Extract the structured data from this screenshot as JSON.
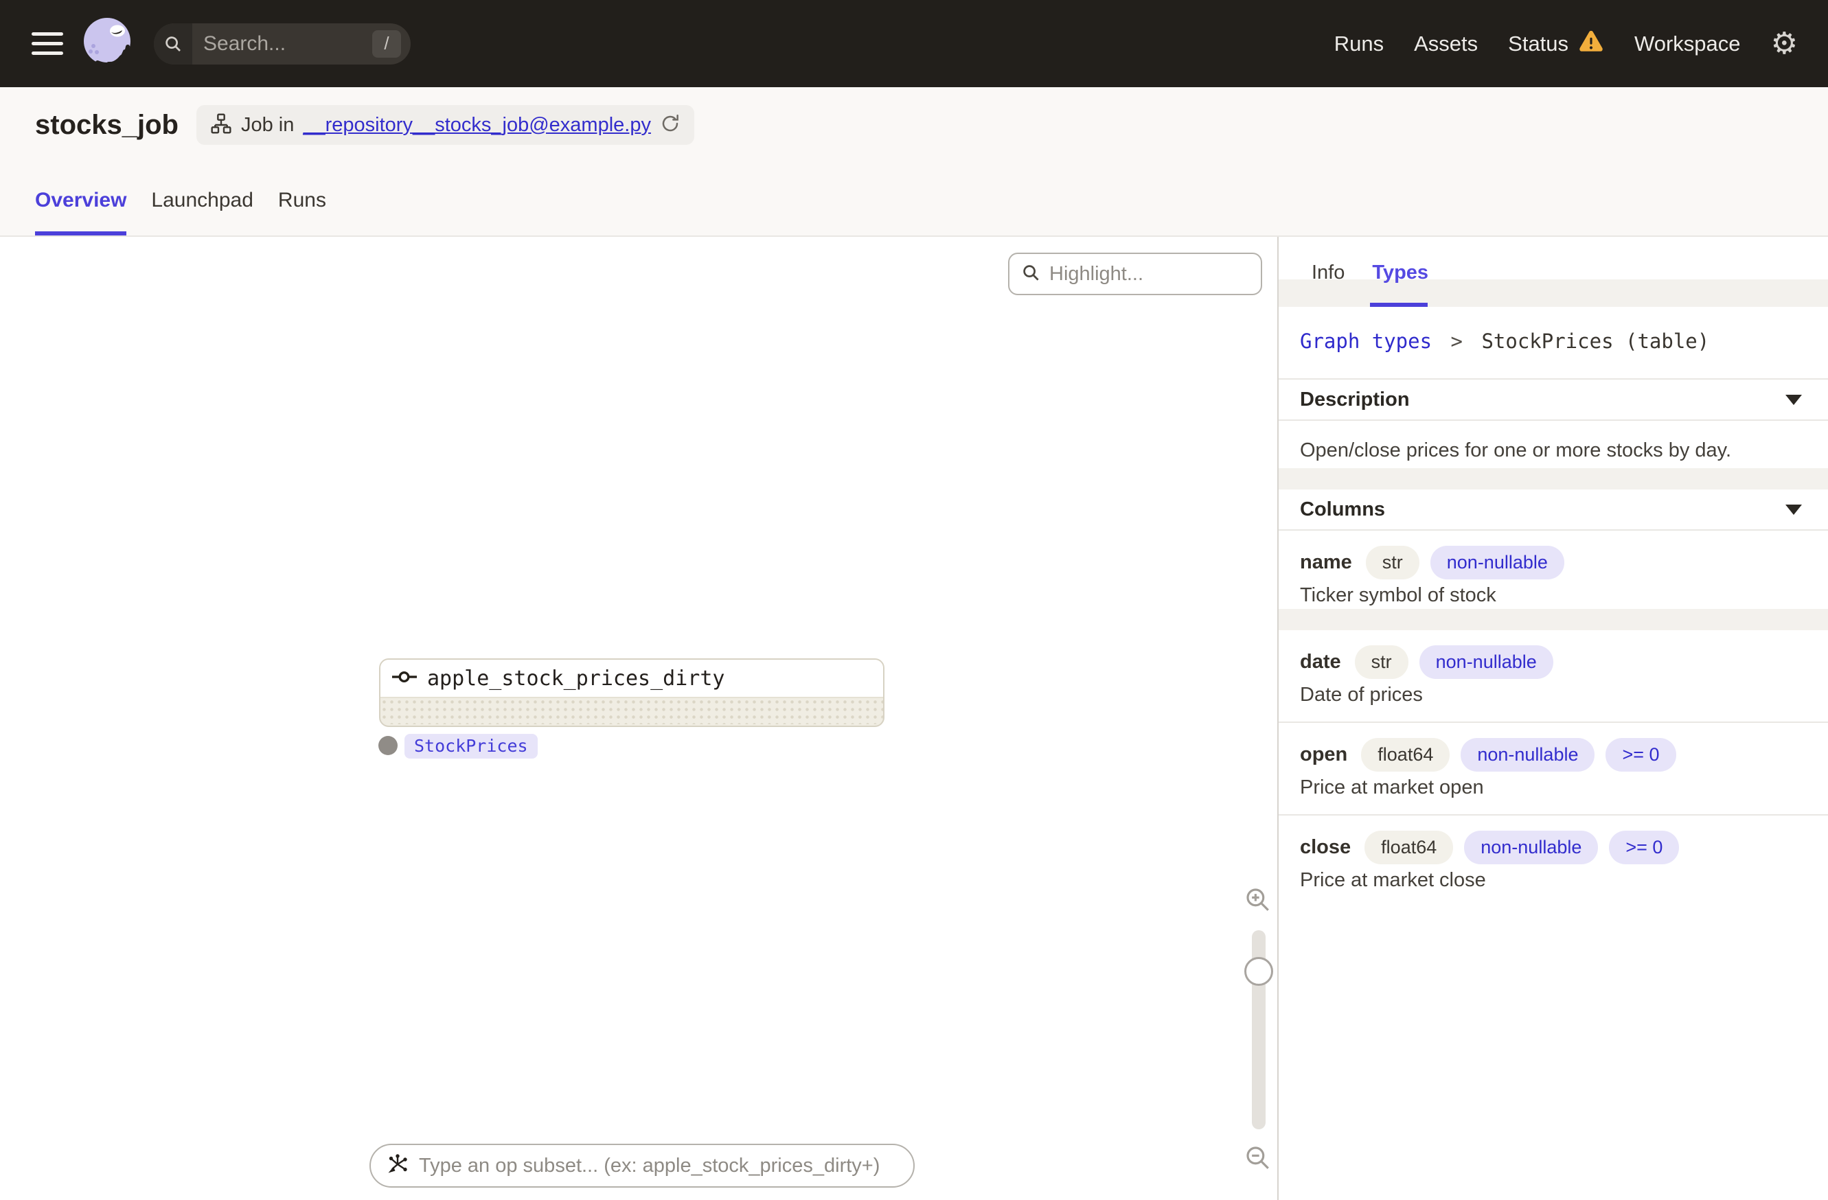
{
  "topbar": {
    "search_placeholder": "Search...",
    "search_shortcut": "/",
    "nav": [
      {
        "label": "Runs"
      },
      {
        "label": "Assets"
      },
      {
        "label": "Status",
        "warning": true
      },
      {
        "label": "Workspace"
      }
    ],
    "gear_glyph": "⚙"
  },
  "header": {
    "title": "stocks_job",
    "job_chip": {
      "prefix": "Job in",
      "link": "__repository__stocks_job@example.py"
    },
    "tabs": [
      {
        "label": "Overview",
        "active": true
      },
      {
        "label": "Launchpad"
      },
      {
        "label": "Runs"
      }
    ]
  },
  "canvas": {
    "highlight_placeholder": "Highlight...",
    "node": {
      "title": "apple_stock_prices_dirty",
      "output_tag": "StockPrices"
    },
    "op_subset_placeholder": "Type an op subset... (ex: apple_stock_prices_dirty+)"
  },
  "panel": {
    "tabs": [
      {
        "label": "Info"
      },
      {
        "label": "Types",
        "active": true
      }
    ],
    "breadcrumb": {
      "link": "Graph types",
      "separator": ">",
      "current": "StockPrices (table)"
    },
    "sections": {
      "description_label": "Description",
      "columns_label": "Columns"
    },
    "description": "Open/close prices for one or more stocks by day.",
    "columns": [
      {
        "name": "name",
        "type": "str",
        "badges": [
          "non-nullable"
        ],
        "description": "Ticker symbol of stock"
      },
      {
        "name": "date",
        "type": "str",
        "badges": [
          "non-nullable"
        ],
        "description": "Date of prices"
      },
      {
        "name": "open",
        "type": "float64",
        "badges": [
          "non-nullable",
          ">= 0"
        ],
        "description": "Price at market open"
      },
      {
        "name": "close",
        "type": "float64",
        "badges": [
          "non-nullable",
          ">= 0"
        ],
        "description": "Price at market close"
      }
    ]
  },
  "colors": {
    "accent": "#4C40DA",
    "link": "#332DCC",
    "warning": "#F2AE3C",
    "topbar": "#221F1B",
    "band": "#F3F1ED",
    "chip-indigo": "#E7E4F9"
  }
}
